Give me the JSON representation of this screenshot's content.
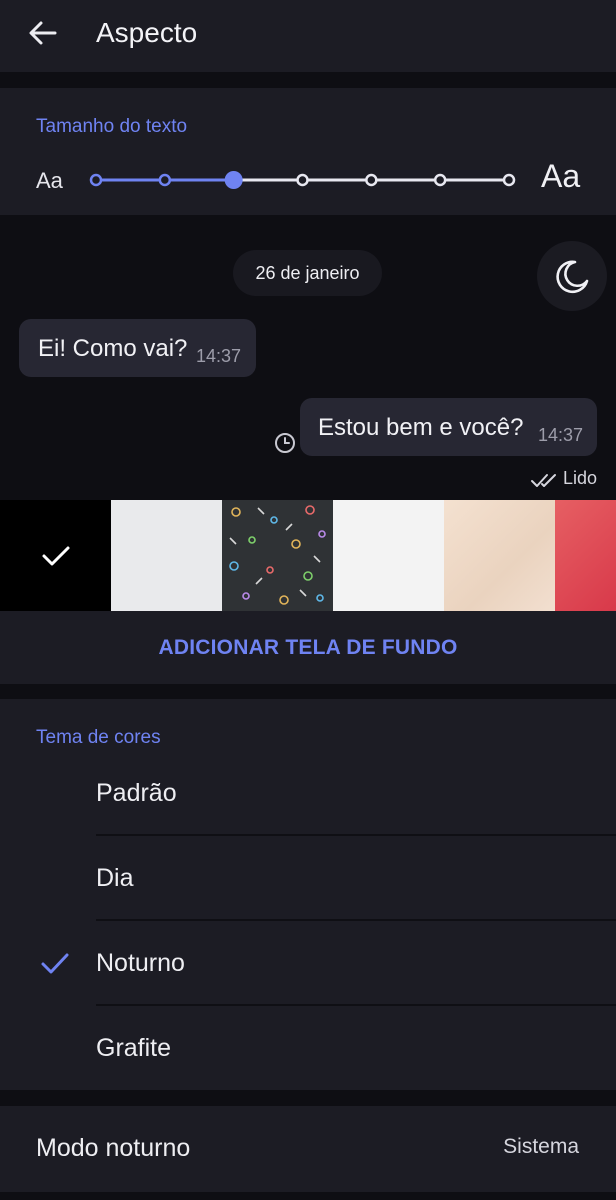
{
  "header": {
    "title": "Aspecto",
    "back_icon": "arrow-left-icon"
  },
  "text_size": {
    "section_title": "Tamanho do texto",
    "small_label": "Aa",
    "large_label": "Aa",
    "steps": 7,
    "selected_step": 3,
    "accent": "#6f83f2"
  },
  "preview": {
    "date": "26 de janeiro",
    "theme_toggle_icon": "moon-icon",
    "incoming": {
      "text": "Ei! Como vai?",
      "time": "14:37"
    },
    "outgoing": {
      "text": "Estou bem e você?",
      "time": "14:37",
      "status_icon": "clock-icon"
    },
    "read_status": "Lido"
  },
  "wallpapers": {
    "items": [
      "black-selected",
      "light-gray",
      "dark-doodle",
      "white",
      "beige-pattern",
      "red-gradient"
    ],
    "selected_index": 0,
    "add_button": "ADICIONAR TELA DE FUNDO"
  },
  "color_theme": {
    "section_title": "Tema de cores",
    "options": [
      {
        "label": "Padrão",
        "selected": false
      },
      {
        "label": "Dia",
        "selected": false
      },
      {
        "label": "Noturno",
        "selected": true
      },
      {
        "label": "Grafite",
        "selected": false
      }
    ]
  },
  "night_mode": {
    "label": "Modo noturno",
    "value": "Sistema"
  },
  "colors": {
    "background": "#0e0e13",
    "card": "#1c1c24",
    "accent": "#6f83f2",
    "bubble": "#272733"
  }
}
